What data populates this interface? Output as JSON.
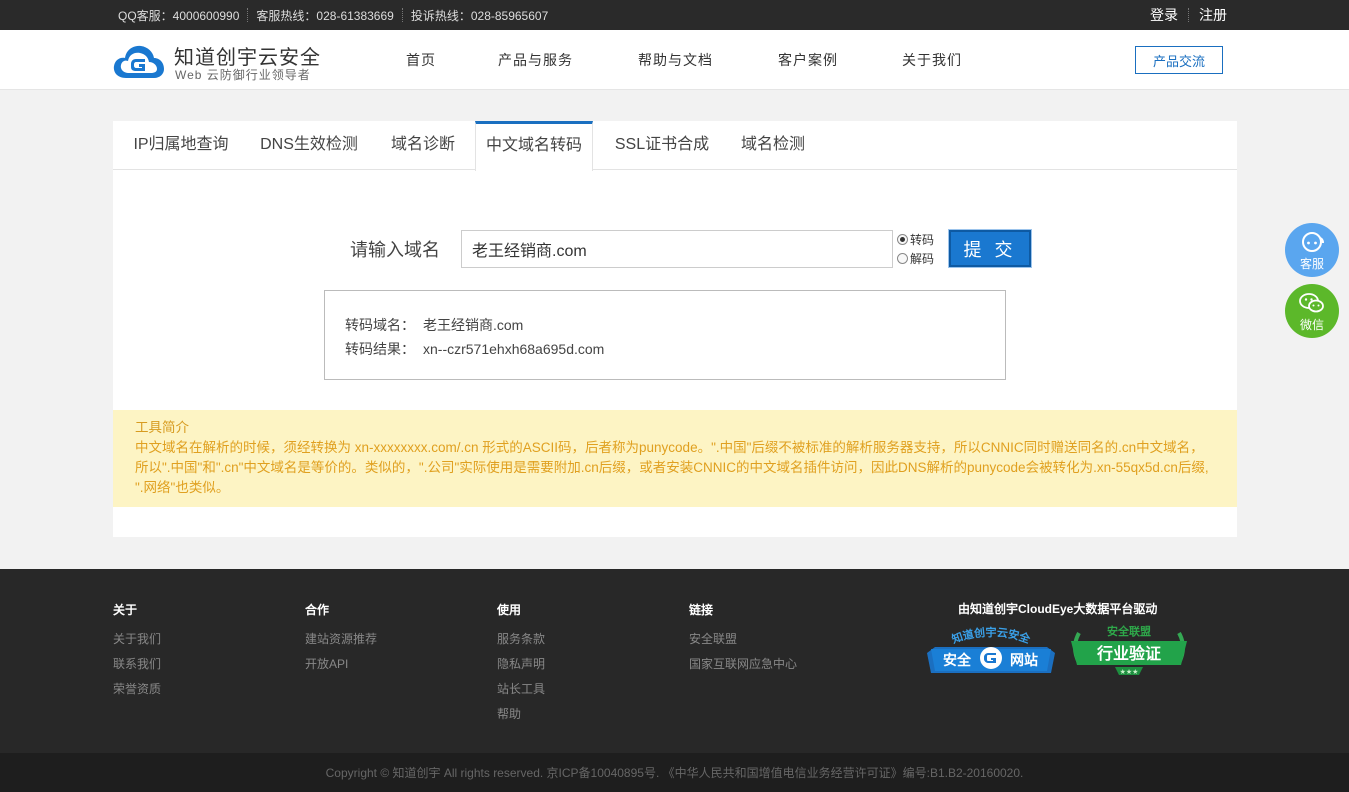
{
  "topbar": {
    "qq": "QQ客服：4000600990",
    "hotline": "客服热线：028-61383669",
    "complaint": "投诉热线：028-85965607",
    "login": "登录",
    "register": "注册"
  },
  "header": {
    "logo_title": "知道创宇云安全",
    "logo_subtitle": "Web 云防御行业领导者",
    "nav": [
      "首页",
      "产品与服务",
      "帮助与文档",
      "客户案例",
      "关于我们"
    ],
    "exchange_button": "产品交流"
  },
  "tabs": [
    "IP归属地查询",
    "DNS生效检测",
    "域名诊断",
    "中文域名转码",
    "SSL证书合成",
    "域名检测"
  ],
  "active_tab": "中文域名转码",
  "form": {
    "label": "请输入域名",
    "input_value": "老王经销商.com",
    "radio_encode": "转码",
    "radio_decode": "解码",
    "selected": "转码",
    "submit": "提 交"
  },
  "result": {
    "domain_label": "转码域名：",
    "domain_value": "老王经销商.com",
    "result_label": "转码结果：",
    "result_value": "xn--czr571ehxh68a695d.com"
  },
  "intro": {
    "title": "工具简介",
    "text": "中文域名在解析的时候，须经转换为 xn-xxxxxxxx.com/.cn 形式的ASCII码，后者称为punycode。\".中国\"后缀不被标准的解析服务器支持，所以CNNIC同时赠送同名的.cn中文域名，所以\".中国\"和\".cn\"中文域名是等价的。类似的，\".公司\"实际使用是需要附加.cn后缀，或者安装CNNIC的中文域名插件访问，因此DNS解析的punycode会被转化为.xn-55qx5d.cn后缀, \".网络\"也类似。"
  },
  "float": {
    "service": "客服",
    "wechat": "微信",
    "service_color": "#5aa6ef",
    "wechat_color": "#5cb82a"
  },
  "footer": {
    "cols": [
      {
        "title": "关于",
        "items": [
          "关于我们",
          "联系我们",
          "荣誉资质"
        ]
      },
      {
        "title": "合作",
        "items": [
          "建站资源推荐",
          "开放API"
        ]
      },
      {
        "title": "使用",
        "items": [
          "服务条款",
          "隐私声明",
          "站长工具",
          "帮助"
        ]
      },
      {
        "title": "链接",
        "items": [
          "安全联盟",
          "国家互联网应急中心"
        ]
      }
    ],
    "powered": "由知道创宇CloudEye大数据平台驱动",
    "badge1": {
      "arc": "知道创宇云安全",
      "left": "安全",
      "right": "网站"
    },
    "badge2": {
      "arc": "安全联盟",
      "main": "行业验证"
    },
    "copyright": "Copyright © 知道创宇 All rights reserved. 京ICP备10040895号. 《中华人民共和国增值电信业务经营许可证》编号:B1.B2-20160020."
  },
  "colors": {
    "brand": "#1a6fc0",
    "intro_bg": "#fdf4c4",
    "intro_text": "#e0a020"
  }
}
